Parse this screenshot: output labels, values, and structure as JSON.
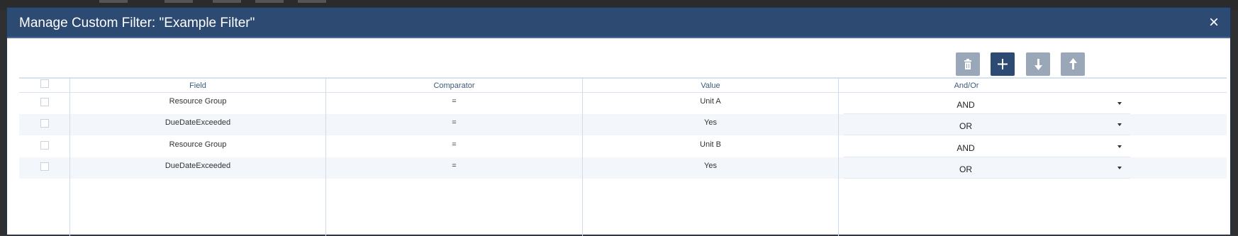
{
  "dialog": {
    "title": "Manage Custom Filter: \"Example Filter\"",
    "close_icon": "×"
  },
  "toolbar": {
    "buttons": [
      {
        "icon": "trash-icon",
        "enabled": false
      },
      {
        "icon": "plus-icon",
        "enabled": true
      },
      {
        "icon": "move-down-icon",
        "enabled": false
      },
      {
        "icon": "move-up-icon",
        "enabled": false
      }
    ]
  },
  "grid": {
    "columns": [
      "Field",
      "Comparator",
      "Value",
      "And/Or"
    ],
    "rows": [
      {
        "field": "Resource Group",
        "comparator": "=",
        "value": "Unit A",
        "andor": "AND"
      },
      {
        "field": "DueDateExceeded",
        "comparator": "=",
        "value": "Yes",
        "andor": "OR"
      },
      {
        "field": "Resource Group",
        "comparator": "=",
        "value": "Unit B",
        "andor": "AND"
      },
      {
        "field": "DueDateExceeded",
        "comparator": "=",
        "value": "Yes",
        "andor": "OR"
      }
    ]
  },
  "colors": {
    "titlebar": "#2c4a72",
    "button_primary": "#2c4a72",
    "button_disabled": "#9aa7b8",
    "row_alt": "#f3f6fa"
  }
}
